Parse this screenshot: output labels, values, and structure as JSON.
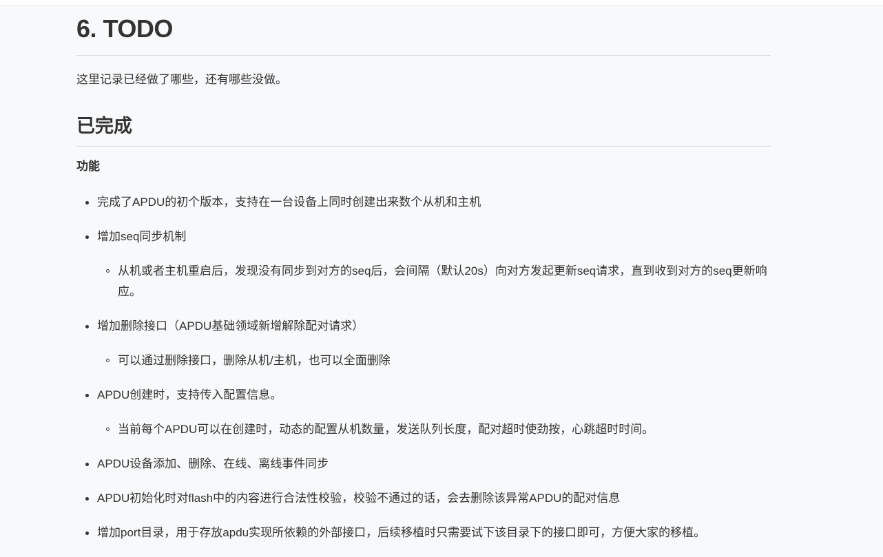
{
  "heading": "6. TODO",
  "intro": "这里记录已经做了哪些，还有哪些没做。",
  "section_title": "已完成",
  "subheading": "功能",
  "items": [
    {
      "text": "完成了APDU的初个版本，支持在一台设备上同时创建出来数个从机和主机",
      "sub": []
    },
    {
      "text": "增加seq同步机制",
      "sub": [
        "从机或者主机重启后，发现没有同步到对方的seq后，会间隔（默认20s）向对方发起更新seq请求，直到收到对方的seq更新响应。"
      ]
    },
    {
      "text": "增加删除接口（APDU基础领域新增解除配对请求）",
      "sub": [
        "可以通过删除接口，删除从机/主机，也可以全面删除"
      ]
    },
    {
      "text": "APDU创建时，支持传入配置信息。",
      "sub": [
        "当前每个APDU可以在创建时，动态的配置从机数量，发送队列长度，配对超时使劲按，心跳超时时间。"
      ]
    },
    {
      "text": "APDU设备添加、删除、在线、离线事件同步",
      "sub": []
    },
    {
      "text": "APDU初始化时对flash中的内容进行合法性校验，校验不通过的话，会去删除该异常APDU的配对信息",
      "sub": []
    },
    {
      "text": "增加port目录，用于存放apdu实现所依赖的外部接口，后续移植时只需要试下该目录下的接口即可，方便大家的移植。",
      "sub": []
    }
  ]
}
